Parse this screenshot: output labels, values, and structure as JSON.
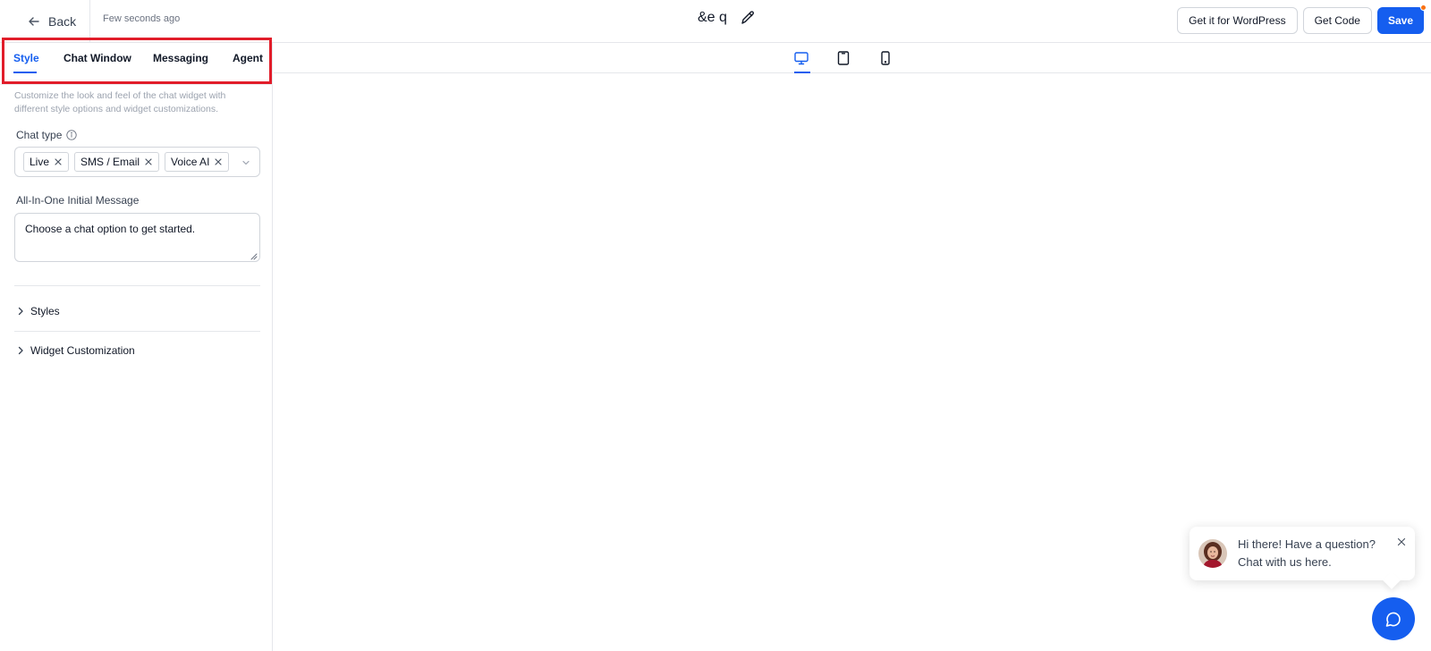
{
  "header": {
    "back_label": "Back",
    "saved_status": "Few seconds ago",
    "widget_name": "&e q",
    "wordpress_label": "Get it for WordPress",
    "get_code_label": "Get Code",
    "save_label": "Save"
  },
  "tabs": [
    {
      "label": "Style",
      "active": true
    },
    {
      "label": "Chat Window",
      "active": false
    },
    {
      "label": "Messaging",
      "active": false
    },
    {
      "label": "Agent",
      "active": false
    }
  ],
  "style_panel": {
    "description": "Customize the look and feel of the chat widget with different style options and widget customizations.",
    "chat_type": {
      "label": "Chat type",
      "selected": [
        "Live",
        "SMS / Email",
        "Voice AI"
      ]
    },
    "initial_message": {
      "label": "All-In-One Initial Message",
      "value": "Choose a chat option to get started."
    },
    "sections": [
      "Styles",
      "Widget Customization"
    ]
  },
  "device_toggle": {
    "options": [
      "desktop-icon",
      "tablet-icon",
      "mobile-icon"
    ],
    "selected": "desktop-icon"
  },
  "preview": {
    "welcome_line1": "Hi there! Have a question?",
    "welcome_line2": "Chat with us here."
  },
  "colors": {
    "accent": "#155eef",
    "highlight_border": "#e11d2a",
    "notification_dot": "#f97316"
  }
}
